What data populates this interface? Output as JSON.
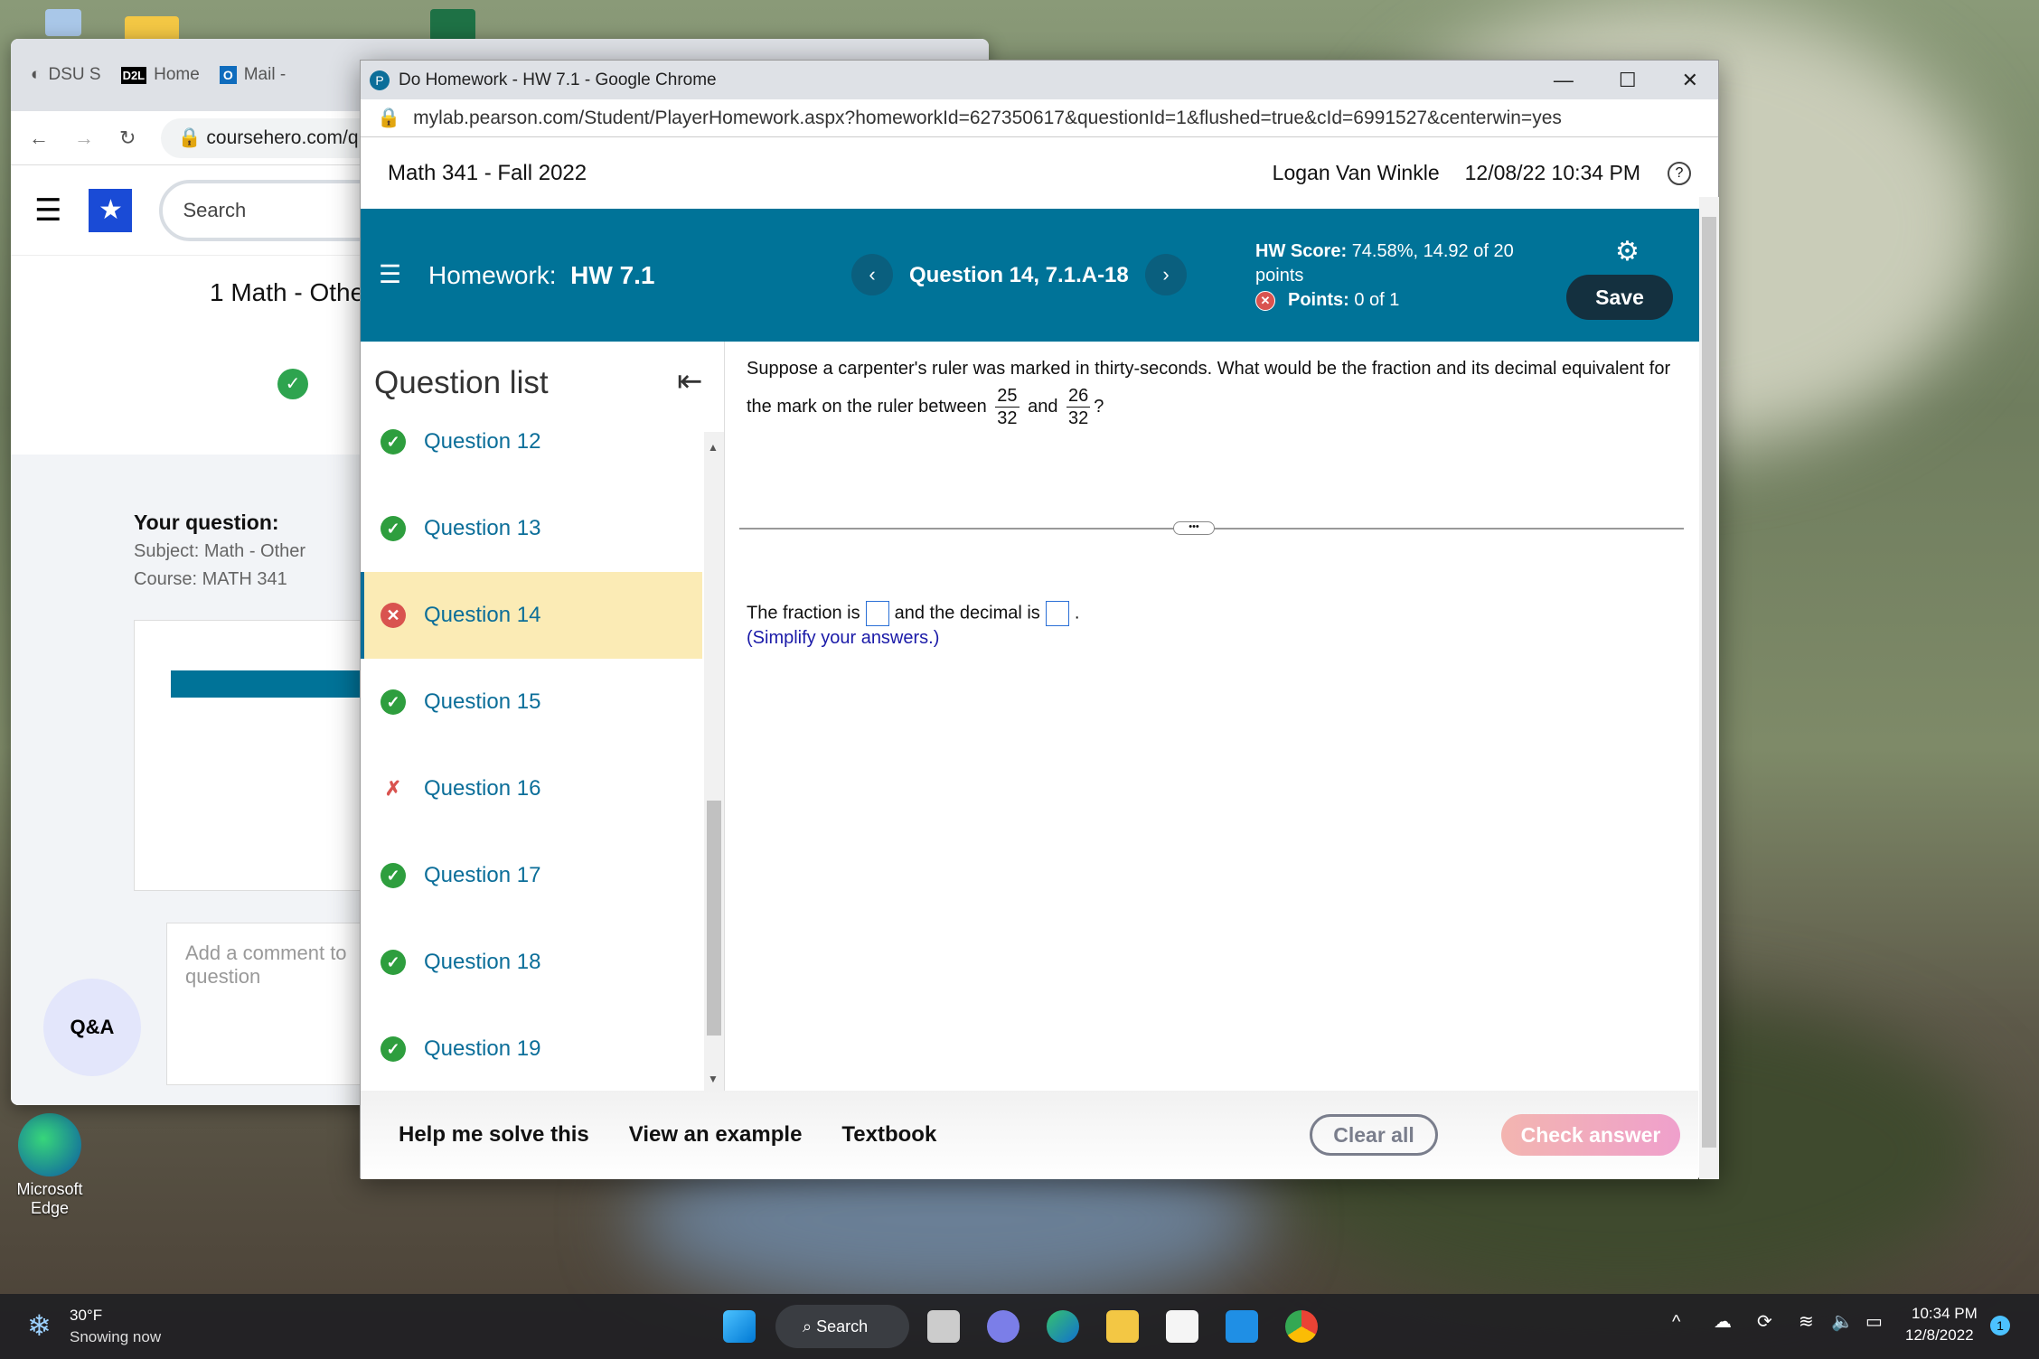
{
  "desktop": {
    "icons": [
      "recycle-bin",
      "folder",
      "excel-file"
    ],
    "edge_label": "Microsoft Edge"
  },
  "back_window": {
    "tabs": [
      "DSU S",
      "Home",
      "Mail -"
    ],
    "url": "coursehero.com/q",
    "search_placeholder": "Search",
    "course_title": "1 Math - Othe",
    "your_question": "Your question:",
    "subject": "Subject: Math - Other",
    "course": "Course: MATH 341",
    "comment_placeholder": "Add a comment to question",
    "qa_label": "Q&A"
  },
  "window": {
    "title": "Do Homework - HW 7.1 - Google Chrome",
    "url": "mylab.pearson.com/Student/PlayerHomework.aspx?homeworkId=627350617&questionId=1&flushed=true&cId=6991527&centerwin=yes"
  },
  "header": {
    "course": "Math 341 - Fall 2022",
    "user": "Logan Van Winkle",
    "datetime": "12/08/22 10:34 PM"
  },
  "toolbar": {
    "homework_label": "Homework:",
    "homework_name": "HW 7.1",
    "question": "Question 14, 7.1.A-18",
    "hw_score_label": "HW Score:",
    "hw_score": "74.58%, 14.92 of 20 points",
    "points_label": "Points:",
    "points": "0 of 1",
    "save": "Save"
  },
  "sidebar": {
    "title": "Question list",
    "items": [
      {
        "label": "Question 12",
        "status": "correct"
      },
      {
        "label": "Question 13",
        "status": "correct"
      },
      {
        "label": "Question 14",
        "status": "incorrect"
      },
      {
        "label": "Question 15",
        "status": "correct"
      },
      {
        "label": "Question 16",
        "status": "partial"
      },
      {
        "label": "Question 17",
        "status": "correct"
      },
      {
        "label": "Question 18",
        "status": "correct"
      },
      {
        "label": "Question 19",
        "status": "correct"
      }
    ]
  },
  "question": {
    "line1": "Suppose a carpenter's ruler was marked in thirty-seconds. What would be the fraction and its decimal equivalent for",
    "line2_pre": "the mark on the ruler between",
    "f1_num": "25",
    "f1_den": "32",
    "and": "and",
    "f2_num": "26",
    "f2_den": "32",
    "q": "?",
    "answer_pre": "The fraction is",
    "answer_mid": "and the decimal is",
    "answer_end": ".",
    "hint": "(Simplify your answers.)"
  },
  "bottom": {
    "help": "Help me solve this",
    "example": "View an example",
    "textbook": "Textbook",
    "clear": "Clear all",
    "check": "Check answer"
  },
  "taskbar": {
    "temp": "30°F",
    "weather": "Snowing now",
    "search": "Search",
    "time": "10:34 PM",
    "date": "12/8/2022",
    "notif": "1"
  },
  "colors": {
    "teal": "#007398",
    "save": "#14303f",
    "correct": "#2e9e3e",
    "incorrect": "#d9534f",
    "active_row": "#fbebb5"
  }
}
